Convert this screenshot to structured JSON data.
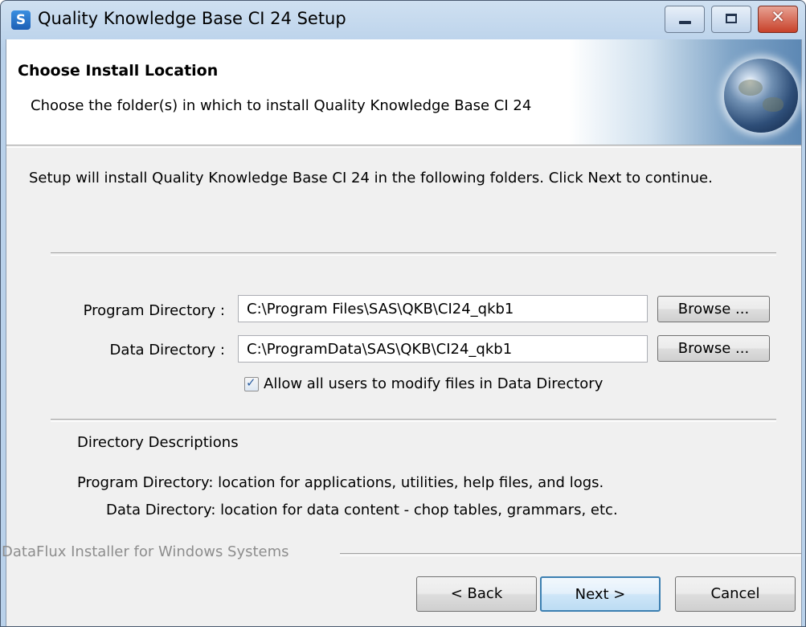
{
  "window": {
    "title": "Quality Knowledge Base CI 24 Setup",
    "app_icon_glyph": "S",
    "close_glyph": "✕"
  },
  "header": {
    "title": "Choose Install Location",
    "subtitle": "Choose the folder(s) in which to install Quality Knowledge Base CI 24"
  },
  "intro": "Setup will install Quality Knowledge Base CI 24 in the following folders. Click Next to continue.",
  "program": {
    "label": "Program Directory :",
    "value": "C:\\Program Files\\SAS\\QKB\\CI24_qkb1",
    "browse_label": "Browse ..."
  },
  "data_dir": {
    "label": "Data Directory :",
    "value": "C:\\ProgramData\\SAS\\QKB\\CI24_qkb1",
    "browse_label": "Browse ..."
  },
  "allow_all": {
    "checked": true,
    "label": "Allow all users to modify files in Data Directory"
  },
  "descriptions": {
    "title": "Directory Descriptions",
    "program": "Program Directory: location for applications, utilities, help files, and logs.",
    "data": "Data Directory: location for data content - chop tables, grammars, etc."
  },
  "footer": {
    "brand": "DataFlux Installer for Windows Systems",
    "back_label": "< Back",
    "next_label": "Next >",
    "cancel_label": "Cancel"
  },
  "colors": {
    "titlebar": "#b9d1ea",
    "dialog_bg": "#f0f0f0",
    "close_button": "#c8412a",
    "default_button_border": "#3c7fb1",
    "check_mark": "#2b5ea0"
  }
}
